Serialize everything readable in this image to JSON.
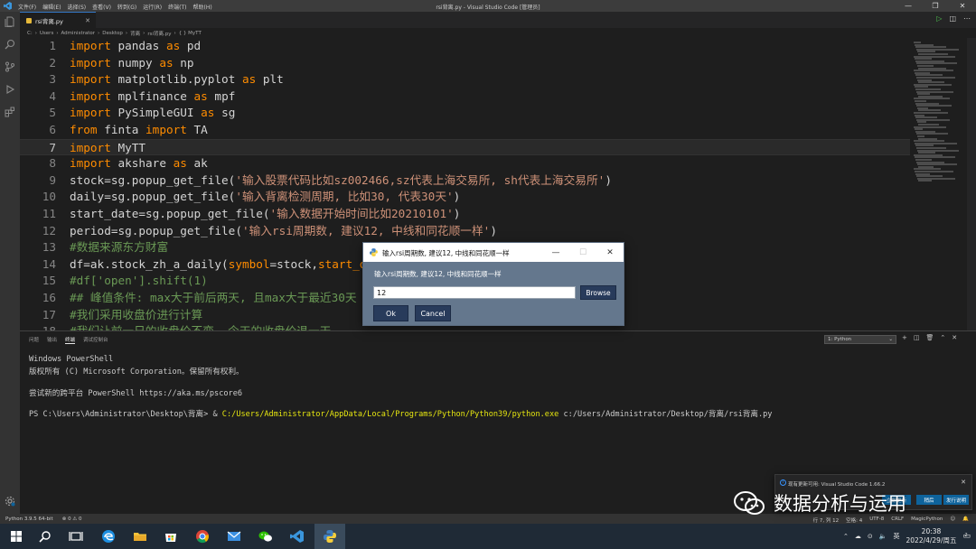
{
  "titlebar": {
    "menu": [
      "文件(F)",
      "编辑(E)",
      "选择(S)",
      "查看(V)",
      "转到(G)",
      "运行(R)",
      "终端(T)",
      "帮助(H)"
    ],
    "window_title": "rsi背离.py - Visual Studio Code [管理员]",
    "minimize": "—",
    "maximize": "❐",
    "close": "✕"
  },
  "tab": {
    "label": "rsi背离.py",
    "close": "✕"
  },
  "breadcrumb": [
    "C:",
    "›",
    "Users",
    "›",
    "Administrator",
    "›",
    "Desktop",
    "›",
    "背离",
    "›",
    "rsi背离.py",
    "›",
    "{ } MyTT"
  ],
  "editor": {
    "current_line": 7,
    "lines": [
      {
        "n": "1",
        "tokens": [
          {
            "t": "import",
            "c": "kw"
          },
          {
            "t": " pandas ",
            "c": ""
          },
          {
            "t": "as",
            "c": "kw"
          },
          {
            "t": " pd",
            "c": ""
          }
        ]
      },
      {
        "n": "2",
        "tokens": [
          {
            "t": "import",
            "c": "kw"
          },
          {
            "t": " numpy ",
            "c": ""
          },
          {
            "t": "as",
            "c": "kw"
          },
          {
            "t": " np",
            "c": ""
          }
        ]
      },
      {
        "n": "3",
        "tokens": [
          {
            "t": "import",
            "c": "kw"
          },
          {
            "t": " matplotlib.pyplot ",
            "c": ""
          },
          {
            "t": "as",
            "c": "kw"
          },
          {
            "t": " plt",
            "c": ""
          }
        ]
      },
      {
        "n": "4",
        "tokens": [
          {
            "t": "import",
            "c": "kw"
          },
          {
            "t": " mplfinance ",
            "c": ""
          },
          {
            "t": "as",
            "c": "kw"
          },
          {
            "t": " mpf",
            "c": ""
          }
        ]
      },
      {
        "n": "5",
        "tokens": [
          {
            "t": "import",
            "c": "kw"
          },
          {
            "t": " PySimpleGUI ",
            "c": ""
          },
          {
            "t": "as",
            "c": "kw"
          },
          {
            "t": " sg",
            "c": ""
          }
        ]
      },
      {
        "n": "6",
        "tokens": [
          {
            "t": "from",
            "c": "kw"
          },
          {
            "t": " finta ",
            "c": ""
          },
          {
            "t": "import",
            "c": "kw"
          },
          {
            "t": " TA",
            "c": ""
          }
        ]
      },
      {
        "n": "7",
        "tokens": [
          {
            "t": "import",
            "c": "kw"
          },
          {
            "t": " MyTT",
            "c": ""
          }
        ]
      },
      {
        "n": "8",
        "tokens": [
          {
            "t": "import",
            "c": "kw"
          },
          {
            "t": " akshare ",
            "c": ""
          },
          {
            "t": "as",
            "c": "kw"
          },
          {
            "t": " ak",
            "c": ""
          }
        ]
      },
      {
        "n": "9",
        "tokens": [
          {
            "t": "stock=sg.popup_get_file(",
            "c": ""
          },
          {
            "t": "'输入股票代码比如sz002466,sz代表上海交易所, sh代表上海交易所'",
            "c": "st"
          },
          {
            "t": ")",
            "c": ""
          }
        ]
      },
      {
        "n": "10",
        "tokens": [
          {
            "t": "daily=sg.popup_get_file(",
            "c": ""
          },
          {
            "t": "'输入背离检测周期, 比如30, 代表30天'",
            "c": "st"
          },
          {
            "t": ")",
            "c": ""
          }
        ]
      },
      {
        "n": "11",
        "tokens": [
          {
            "t": "start_date=sg.popup_get_file(",
            "c": ""
          },
          {
            "t": "'输入数据开始时间比如20210101'",
            "c": "st"
          },
          {
            "t": ")",
            "c": ""
          }
        ]
      },
      {
        "n": "12",
        "tokens": [
          {
            "t": "period=sg.popup_get_file(",
            "c": ""
          },
          {
            "t": "'输入rsi周期数, 建议12, 中线和同花顺一样'",
            "c": "st"
          },
          {
            "t": ")",
            "c": ""
          }
        ]
      },
      {
        "n": "13",
        "tokens": [
          {
            "t": "#数据来源东方财富",
            "c": "cm"
          }
        ]
      },
      {
        "n": "14",
        "tokens": [
          {
            "t": "df=ak.stock_zh_a_daily(",
            "c": ""
          },
          {
            "t": "symbol",
            "c": "pm"
          },
          {
            "t": "=stock,",
            "c": ""
          },
          {
            "t": "start_d",
            "c": "pm"
          }
        ]
      },
      {
        "n": "15",
        "tokens": [
          {
            "t": "#df['open'].shift(1)",
            "c": "cm"
          }
        ]
      },
      {
        "n": "16",
        "tokens": [
          {
            "t": "## 峰值条件: max大于前后两天, 且max大于最近30天",
            "c": "cm"
          }
        ]
      },
      {
        "n": "17",
        "tokens": [
          {
            "t": "#我们采用收盘价进行计算",
            "c": "cm"
          }
        ]
      },
      {
        "n": "18",
        "tokens": [
          {
            "t": "#我们让前一日的收盘价不变, 今天的收盘价退一天",
            "c": "cm"
          }
        ]
      }
    ]
  },
  "panel": {
    "tabs": [
      "问题",
      "输出",
      "终端",
      "调试控制台"
    ],
    "active_tab": "终端",
    "terminal_select": "1: Python",
    "terminal": {
      "l1": "Windows PowerShell",
      "l2": "版权所有 (C) Microsoft Corporation。保留所有权利。",
      "l3": "尝试新的跨平台 PowerShell https://aka.ms/pscore6",
      "prompt": "PS C:\\Users\\Administrator\\Desktop\\背离> & ",
      "exe": "C:/Users/Administrator/AppData/Local/Programs/Python/Python39/python.exe",
      "script": " c:/Users/Administrator/Desktop/背离/rsi背离.py"
    }
  },
  "statusbar": {
    "left": [
      "Python 3.9.5 64-bit",
      "⊗ 0 ⚠ 0"
    ],
    "right": [
      "行 7, 列 12",
      "空格: 4",
      "UTF-8",
      "CRLF",
      "MagicPython"
    ]
  },
  "dialog": {
    "title": "输入rsi周期数, 建议12, 中线和同花顺一样",
    "label": "输入rsi周期数, 建议12, 中线和同花顺一样",
    "input_value": "12",
    "browse": "Browse",
    "ok": "Ok",
    "cancel": "Cancel",
    "minimize": "—",
    "maximize": "☐",
    "close": "✕"
  },
  "notification": {
    "text": "现有更新可用: Visual Studio Code 1.66.2",
    "close": "✕",
    "btn_install": "立即更新",
    "btn_later": "稍后",
    "btn_notes": "发行说明"
  },
  "watermark": {
    "text": "数据分析与运用"
  },
  "taskbar": {
    "ime": "英",
    "time": "20:38",
    "date": "2022/4/29/周五",
    "notif_count": "2"
  },
  "colors": {
    "accent": "#3478c6",
    "dialog_bg": "#64778d",
    "dialog_button": "#283b5b",
    "keyword": "#ff8c00",
    "string": "#ce9178"
  }
}
